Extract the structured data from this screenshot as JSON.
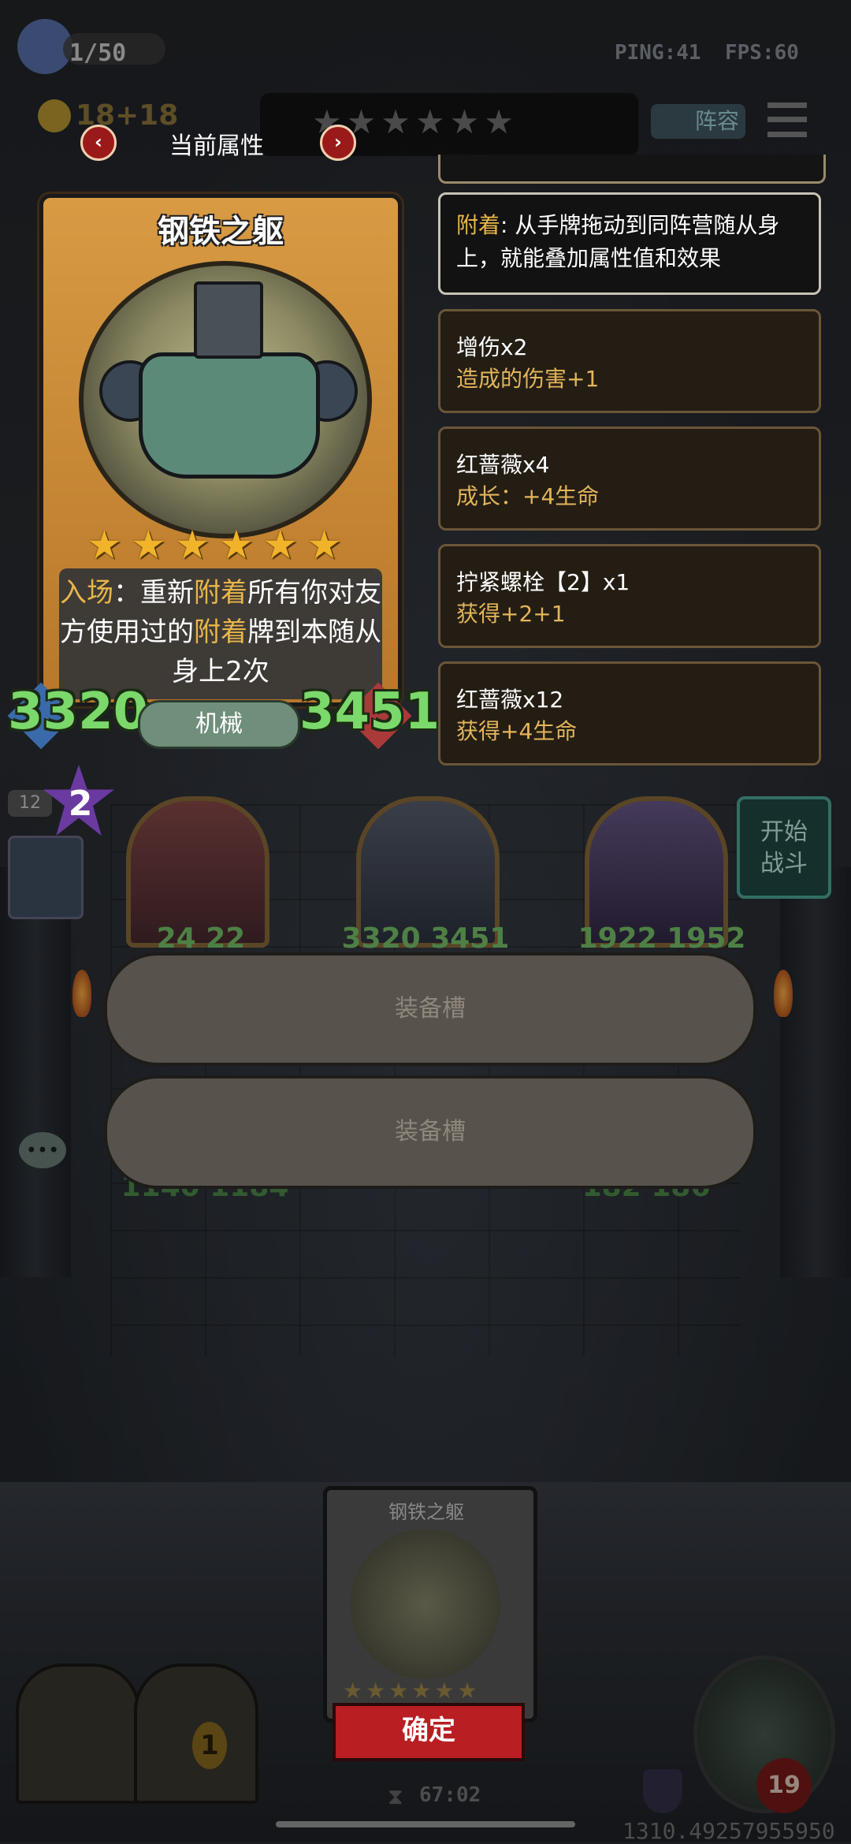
{
  "hud": {
    "player_count": "1/50",
    "ping": "PING:41",
    "fps": "FPS:60",
    "coins": "18",
    "coin_income": "+18",
    "lineup_button": "阵容",
    "timer": "67:02",
    "coordinate_readout": "1310.49257955950",
    "health": "19",
    "gold_count": "1",
    "level_badge": "2",
    "level_tag": "12"
  },
  "attribute_panel": {
    "title": "当前属性",
    "attach_label": "附着",
    "attach_text": ": 从手牌拖动到同阵营随从身上，就能叠加属性值和效果",
    "buffs": [
      {
        "title": "增伤x2",
        "detail": "造成的伤害+1"
      },
      {
        "title": "红蔷薇x4",
        "detail": "成长：+4生命"
      },
      {
        "title": "拧紧螺栓【2】x1",
        "detail": "获得+2+1"
      },
      {
        "title": "红蔷薇x12",
        "detail": "获得+4生命"
      }
    ]
  },
  "card": {
    "name": "钢铁之躯",
    "stars": 6,
    "desc_part1": "入场",
    "desc_part2": "：重新",
    "desc_part3": "附着",
    "desc_part4": "所有你对友方使用过的",
    "desc_part5": "附着",
    "desc_part6": "牌到本随从身上2次",
    "attack": "3320",
    "health": "3451",
    "tribe": "机械"
  },
  "board": {
    "minion_stats": [
      "24   22",
      "3320  3451",
      "1922  1952"
    ],
    "lower_stats": [
      "1140  1184",
      "182   186"
    ],
    "start_battle": "开始\n战斗"
  },
  "equip_slots": [
    "装备槽",
    "装备槽"
  ],
  "bottom_card": {
    "name": "钢铁之躯",
    "confirm": "确定"
  },
  "colors": {
    "accent_gold": "#e8b64a",
    "stat_green": "#7bd86a",
    "confirm_red": "#b81e22"
  }
}
